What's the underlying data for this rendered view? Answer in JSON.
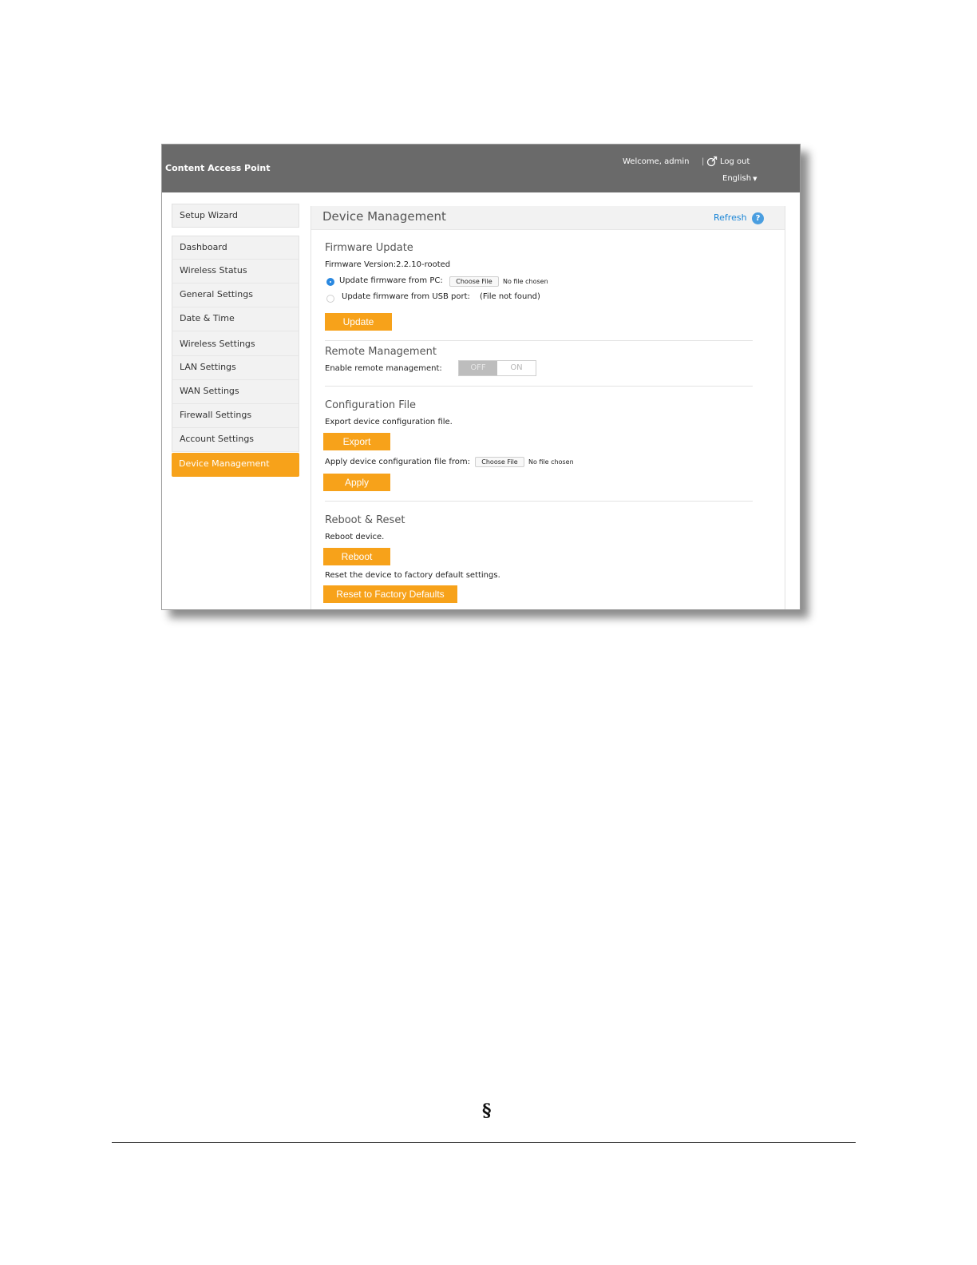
{
  "header": {
    "app_title": "Content Access Point",
    "welcome": "Welcome, admin",
    "separator": "|",
    "logout": "Log out",
    "language": "English",
    "logout_icon": "logout-icon",
    "caret_icon": "caret-down-icon"
  },
  "sidebar": {
    "items": [
      {
        "label": "Setup Wizard"
      },
      {
        "label": "Dashboard"
      },
      {
        "label": "Wireless Status"
      },
      {
        "label": "General Settings"
      },
      {
        "label": "Date & Time"
      },
      {
        "label": "Wireless Settings"
      },
      {
        "label": "LAN Settings"
      },
      {
        "label": "WAN Settings"
      },
      {
        "label": "Firewall Settings"
      },
      {
        "label": "Account Settings"
      },
      {
        "label": "Device Management",
        "active": true
      }
    ]
  },
  "main": {
    "title": "Device Management",
    "refresh": "Refresh",
    "help": "?",
    "firmware": {
      "title": "Firmware Update",
      "version": "Firmware Version:2.2.10-rooted",
      "option_pc": "Update firmware from PC:",
      "option_usb": "Update firmware from USB port:",
      "usb_status": "(File not found)",
      "choose_file": "Choose File",
      "no_file": "No file chosen",
      "selected_option": "pc",
      "update_button": "Update"
    },
    "remote": {
      "title": "Remote Management",
      "label": "Enable remote management:",
      "off": "OFF",
      "on": "ON",
      "state": "OFF"
    },
    "config": {
      "title": "Configuration File",
      "export_text": "Export device configuration file.",
      "export_button": "Export",
      "apply_text": "Apply device configuration file from:",
      "choose_file": "Choose File",
      "no_file": "No file chosen",
      "apply_button": "Apply"
    },
    "reboot": {
      "title": "Reboot & Reset",
      "reboot_text": "Reboot device.",
      "reboot_button": "Reboot",
      "reset_text": "Reset the device to factory default settings.",
      "reset_button": "Reset to Factory Defaults"
    }
  },
  "page": {
    "section_mark": "§"
  },
  "colors": {
    "header_bg": "#6a6a6a",
    "accent": "#f7a21a",
    "link": "#1a85d6"
  }
}
